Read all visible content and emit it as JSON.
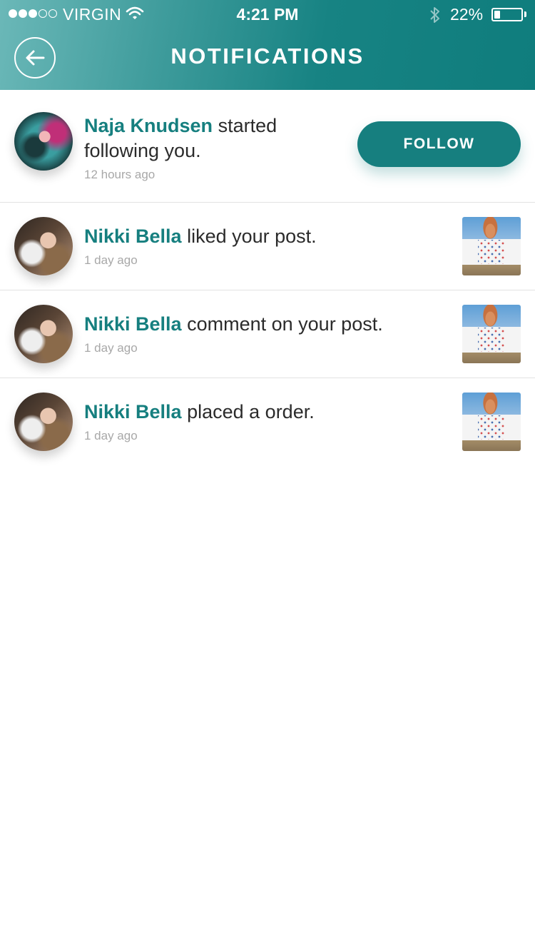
{
  "status_bar": {
    "carrier": "VIRGIN",
    "time": "4:21 PM",
    "battery_percent": "22%",
    "battery_level": 0.22,
    "signal_bars": 3,
    "signal_total": 5
  },
  "header": {
    "title": "NOTIFICATIONS",
    "back_icon": "arrow-left-icon"
  },
  "notifications": [
    {
      "user": "Naja Knudsen",
      "action": "started following you.",
      "time": "12 hours ago",
      "button_label": "FOLLOW"
    },
    {
      "user": "Nikki Bella",
      "action": "liked your post.",
      "time": "1 day ago"
    },
    {
      "user": "Nikki Bella",
      "action": "comment on your post.",
      "time": "1 day ago"
    },
    {
      "user": "Nikki Bella",
      "action": "placed a order.",
      "time": "1 day ago"
    }
  ],
  "colors": {
    "accent": "#167f7f",
    "header_start": "#6bb8b8",
    "header_end": "#0f7d7d",
    "timestamp": "#a8a8a8",
    "divider": "#e3e3e3"
  }
}
